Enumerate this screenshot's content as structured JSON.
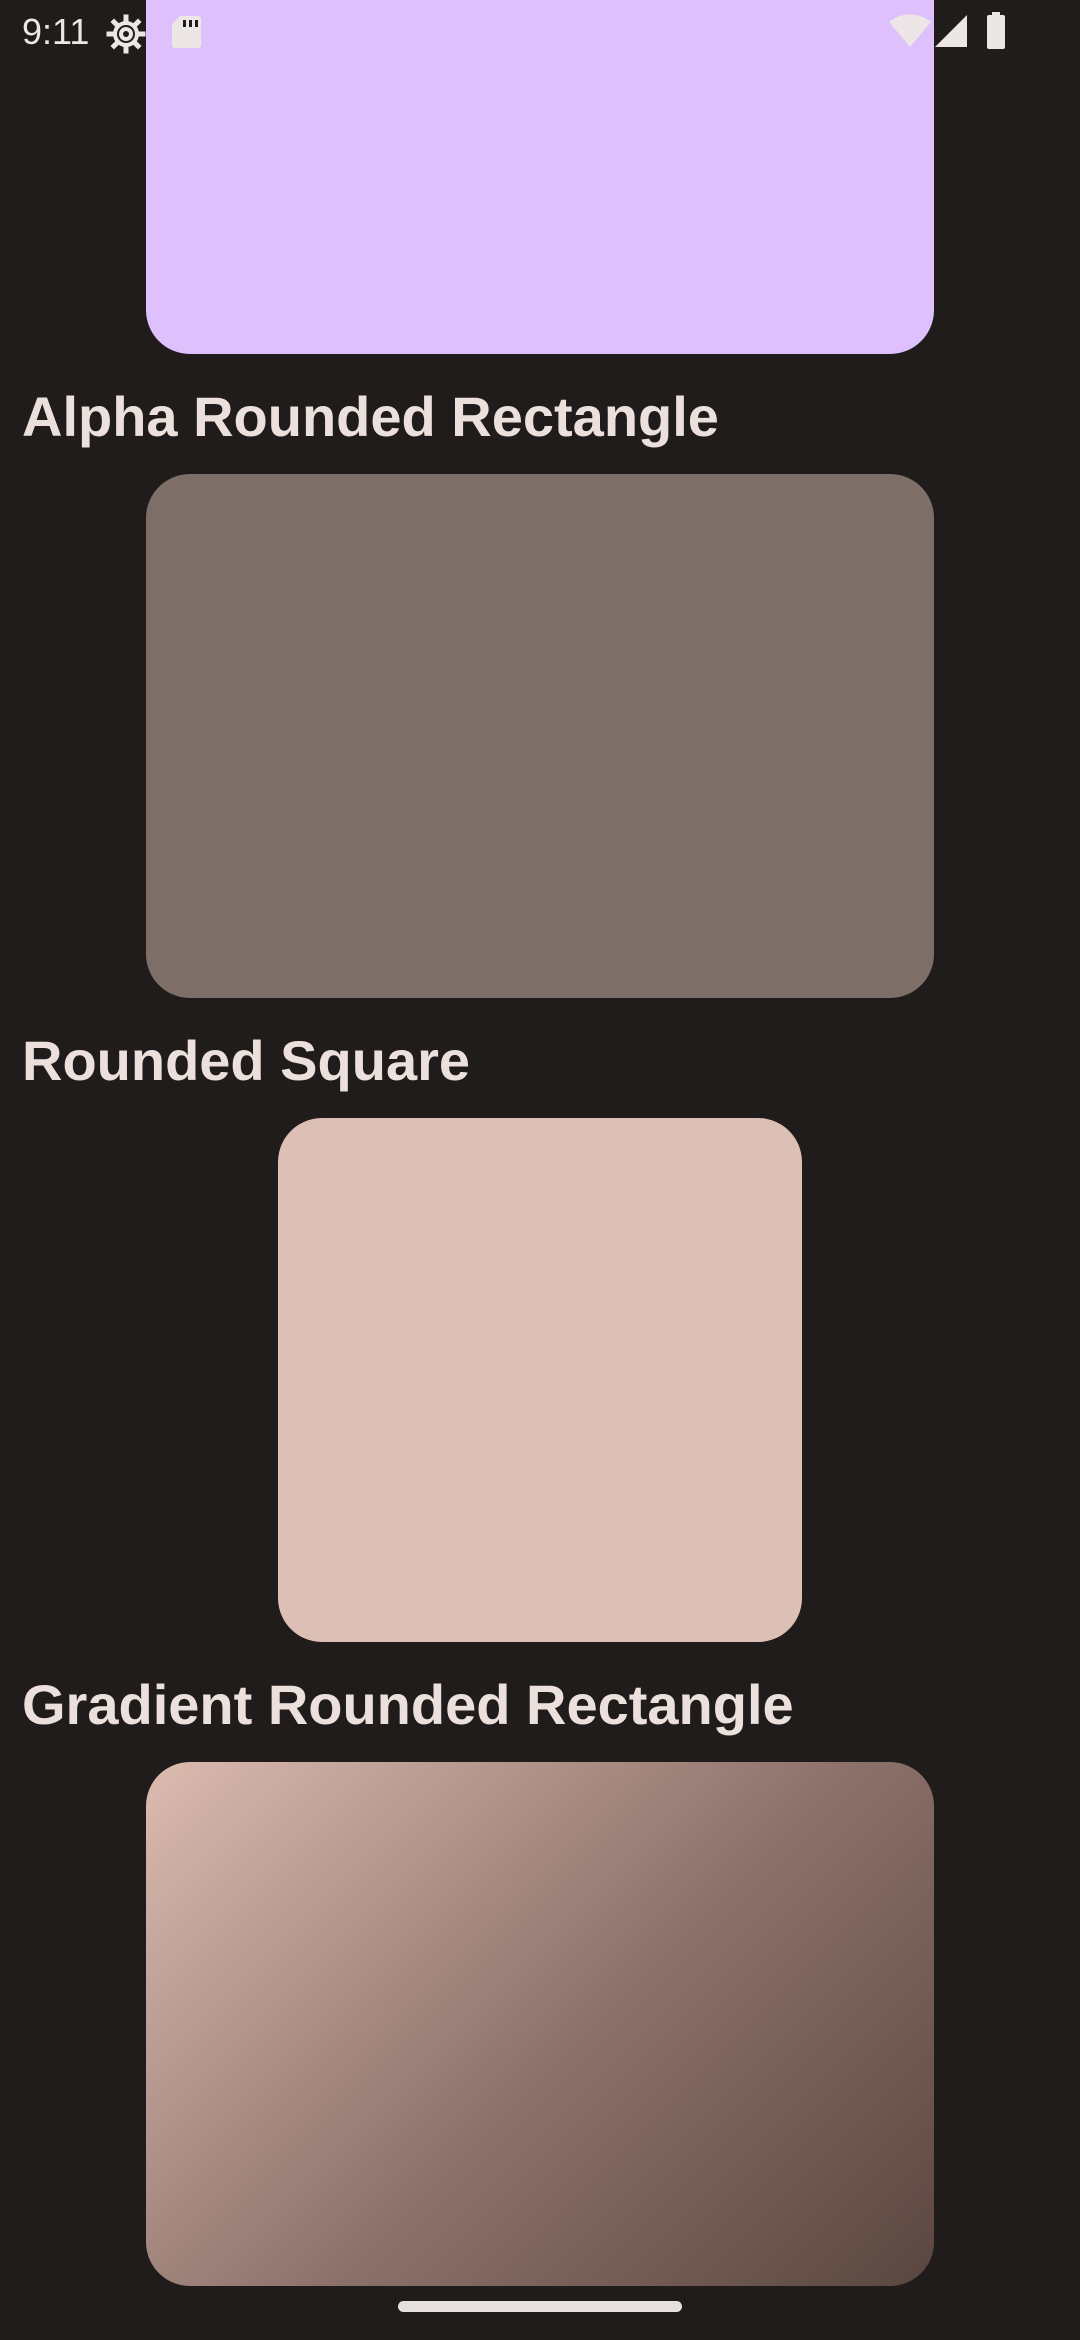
{
  "status_bar": {
    "time": "9:11",
    "icons": [
      "settings-icon",
      "sd-card-icon",
      "wifi-icon",
      "cellular-signal-icon",
      "battery-icon"
    ]
  },
  "sections": [
    {
      "title": "",
      "shape_color": "#ddc0fc"
    },
    {
      "title": "Alpha Rounded Rectangle",
      "shape_color": "#7e6e68"
    },
    {
      "title": "Rounded Square",
      "shape_color": "#ddc0b5"
    },
    {
      "title": "Gradient Rounded Rectangle",
      "gradient_start": "#dcbbb0",
      "gradient_end": "#5a4640"
    }
  ],
  "colors": {
    "background": "#201c1c",
    "text": "#ece0dc"
  }
}
